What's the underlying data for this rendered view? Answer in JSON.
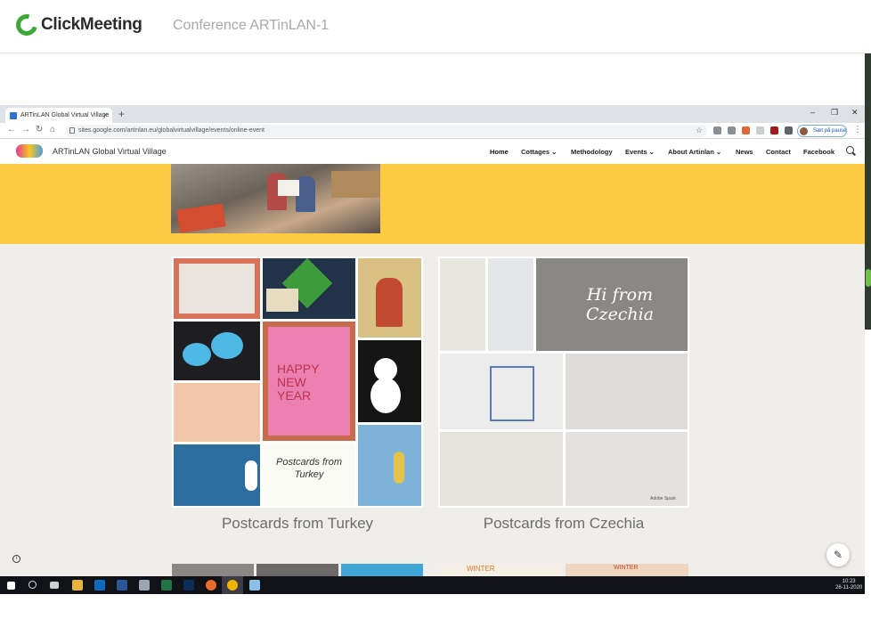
{
  "clickmeeting": {
    "logo_text": "ClickMeeting",
    "conference_title": "Conference ARTinLAN-1"
  },
  "browser": {
    "tab_title": "ARTinLAN Global Virtual Village",
    "tab_close": "×",
    "new_tab": "+",
    "window_controls": [
      "–",
      "❐",
      "✕"
    ],
    "url": "sites.google.com/artinlan.eu/globalvirtualvillage/events/online-event",
    "profile_button": "Sæt på pause"
  },
  "site": {
    "title": "ARTinLAN Global Virtual Village",
    "menu": [
      {
        "label": "Home"
      },
      {
        "label": "Cottages ⌄"
      },
      {
        "label": "Methodology"
      },
      {
        "label": "Events ⌄"
      },
      {
        "label": "About Artinlan ⌄"
      },
      {
        "label": "News"
      },
      {
        "label": "Contact"
      },
      {
        "label": "Facebook"
      }
    ]
  },
  "galleries": [
    {
      "caption": "Postcards from Turkey",
      "tiles": {
        "happy_new_year": "HAPPY NEW YEAR",
        "postcards_from": "Postcards from Turkey"
      }
    },
    {
      "caption": "Postcards from Czechia",
      "tiles": {
        "hi_from": "Hi from Czechia",
        "watermark": "Adobe Spark"
      }
    }
  ],
  "bottom_tiles": {
    "winter_left": "WINTER",
    "winter_right": "WINTER"
  },
  "taskbar": {
    "time": "10:23",
    "date": "26-11-2020"
  },
  "colors": {
    "banner": "#fccb43",
    "page_bg": "#efeeeb",
    "clickmeeting_green": "#3aa935"
  },
  "icons": [
    "info-icon",
    "edit-pencil-icon",
    "search-icon",
    "windows-start-icon"
  ]
}
